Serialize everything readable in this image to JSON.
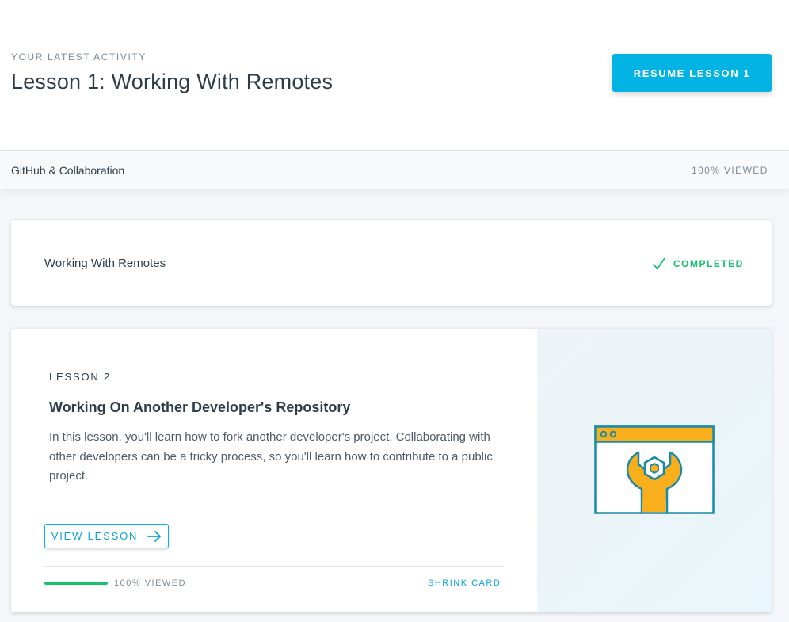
{
  "header": {
    "eyebrow": "YOUR LATEST ACTIVITY",
    "title": "Lesson 1: Working With Remotes",
    "resume_label": "RESUME LESSON 1"
  },
  "course_bar": {
    "name": "GitHub & Collaboration",
    "progress_label": "100% VIEWED"
  },
  "lessons": [
    {
      "title": "Working With Remotes",
      "status_label": "COMPLETED",
      "status_icon": "check-icon"
    },
    {
      "number_label": "LESSON 2",
      "title": "Working On Another Developer's Repository",
      "description": "In this lesson, you'll learn how to fork another developer's project. Collaborating with other developers can be a tricky process, so you'll learn how to contribute to a public project.",
      "view_label": "VIEW LESSON",
      "view_icon": "arrow-right-icon",
      "progress": 1.0,
      "progress_label": "100% VIEWED",
      "shrink_label": "SHRINK CARD",
      "illustration": "browser-wrench-icon"
    }
  ],
  "colors": {
    "accent": "#02b3e4",
    "success": "#15c26b",
    "illustration_orange": "#f9ae1b",
    "illustration_teal": "#1b8aa8"
  }
}
